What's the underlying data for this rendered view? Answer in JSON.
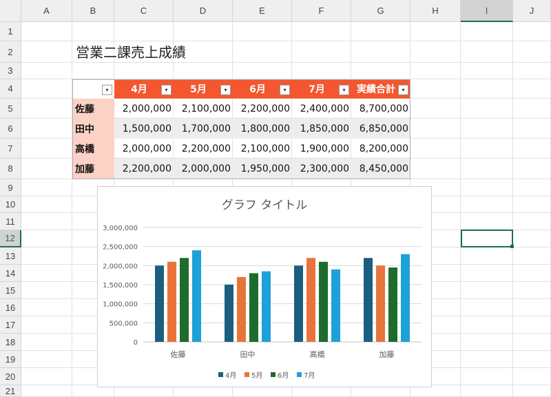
{
  "sheet": {
    "columns": [
      "A",
      "B",
      "C",
      "D",
      "E",
      "F",
      "G",
      "H",
      "I",
      "J"
    ],
    "rows": [
      "1",
      "2",
      "3",
      "4",
      "5",
      "6",
      "7",
      "8",
      "9",
      "10",
      "11",
      "12",
      "13",
      "14",
      "15",
      "16",
      "17",
      "18",
      "19",
      "20",
      "21"
    ],
    "selected_column": "I",
    "selected_row": "12"
  },
  "table": {
    "title": "営業二課売上成績",
    "headers": [
      "4月",
      "5月",
      "6月",
      "7月",
      "実績合計"
    ],
    "rows": [
      {
        "name": "佐藤",
        "values": [
          "2,000,000",
          "2,100,000",
          "2,200,000",
          "2,400,000",
          "8,700,000"
        ]
      },
      {
        "name": "田中",
        "values": [
          "1,500,000",
          "1,700,000",
          "1,800,000",
          "1,850,000",
          "6,850,000"
        ]
      },
      {
        "name": "高橋",
        "values": [
          "2,000,000",
          "2,200,000",
          "2,100,000",
          "1,900,000",
          "8,200,000"
        ]
      },
      {
        "name": "加藤",
        "values": [
          "2,200,000",
          "2,000,000",
          "1,950,000",
          "2,300,000",
          "8,450,000"
        ]
      }
    ],
    "dropdown_icon": "filter-dropdown-icon",
    "header_color": "#F4562F",
    "name_color": "#FCD2C6"
  },
  "chart_data": {
    "type": "bar",
    "title": "グラフ タイトル",
    "categories": [
      "佐藤",
      "田中",
      "高橋",
      "加藤"
    ],
    "series": [
      {
        "name": "4月",
        "color": "#1B5E80",
        "values": [
          2000000,
          1500000,
          2000000,
          2200000
        ]
      },
      {
        "name": "5月",
        "color": "#E8743B",
        "values": [
          2100000,
          1700000,
          2200000,
          2000000
        ]
      },
      {
        "name": "6月",
        "color": "#1E6B2E",
        "values": [
          2200000,
          1800000,
          2100000,
          1950000
        ]
      },
      {
        "name": "7月",
        "color": "#1EA0D8",
        "values": [
          2400000,
          1850000,
          1900000,
          2300000
        ]
      }
    ],
    "ylim": [
      0,
      3000000
    ],
    "yticks": [
      "0",
      "500,000",
      "1,000,000",
      "1,500,000",
      "2,000,000",
      "2,500,000",
      "3,000,000"
    ],
    "grid": true,
    "legend_position": "bottom"
  }
}
